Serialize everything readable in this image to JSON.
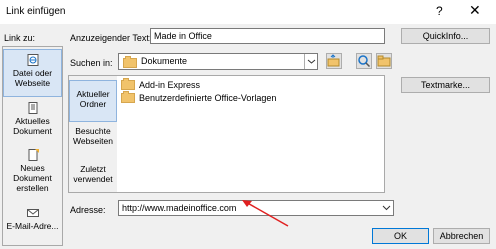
{
  "window": {
    "title": "Link einfügen",
    "help_glyph": "?",
    "close_glyph": "✕"
  },
  "labels": {
    "link_zu": "Link zu:",
    "anzuzeigender_text": "Anzuzeigender Text:",
    "suchen_in": "Suchen in:",
    "adresse": "Adresse:"
  },
  "fields": {
    "display_text_value": "Made in Office",
    "look_in_value": "Dokumente",
    "address_value": "http://www.madeinoffice.com"
  },
  "link_to": {
    "items": [
      {
        "label_line1": "Datei oder",
        "label_line2": "Webseite",
        "selected": true,
        "icon": "file-web-icon"
      },
      {
        "label_line1": "Aktuelles",
        "label_line2": "Dokument",
        "selected": false,
        "icon": "document-icon"
      },
      {
        "label_line1": "Neues",
        "label_line2": "Dokument",
        "label_line3": "erstellen",
        "selected": false,
        "icon": "new-document-icon"
      },
      {
        "label_line1": "E-Mail-Adre...",
        "selected": false,
        "icon": "email-icon"
      }
    ]
  },
  "left_nav": {
    "items": [
      {
        "line1": "Aktueller",
        "line2": "Ordner",
        "selected": true
      },
      {
        "line1": "Besuchte",
        "line2": "Webseiten",
        "selected": false
      },
      {
        "line1": "Zuletzt",
        "line2": "verwendet",
        "selected": false
      }
    ]
  },
  "folders": [
    {
      "name": "Add-in Express"
    },
    {
      "name": "Benutzerdefinierte Office-Vorlagen"
    }
  ],
  "buttons": {
    "quickinfo": "QuickInfo...",
    "textmarke": "Textmarke...",
    "ok": "OK",
    "abbrechen": "Abbrechen"
  },
  "colors": {
    "selection": "#d9e6f5",
    "annotation_arrow": "#e02020",
    "folder": "#f1c36b",
    "primary_border": "#0078d7"
  }
}
